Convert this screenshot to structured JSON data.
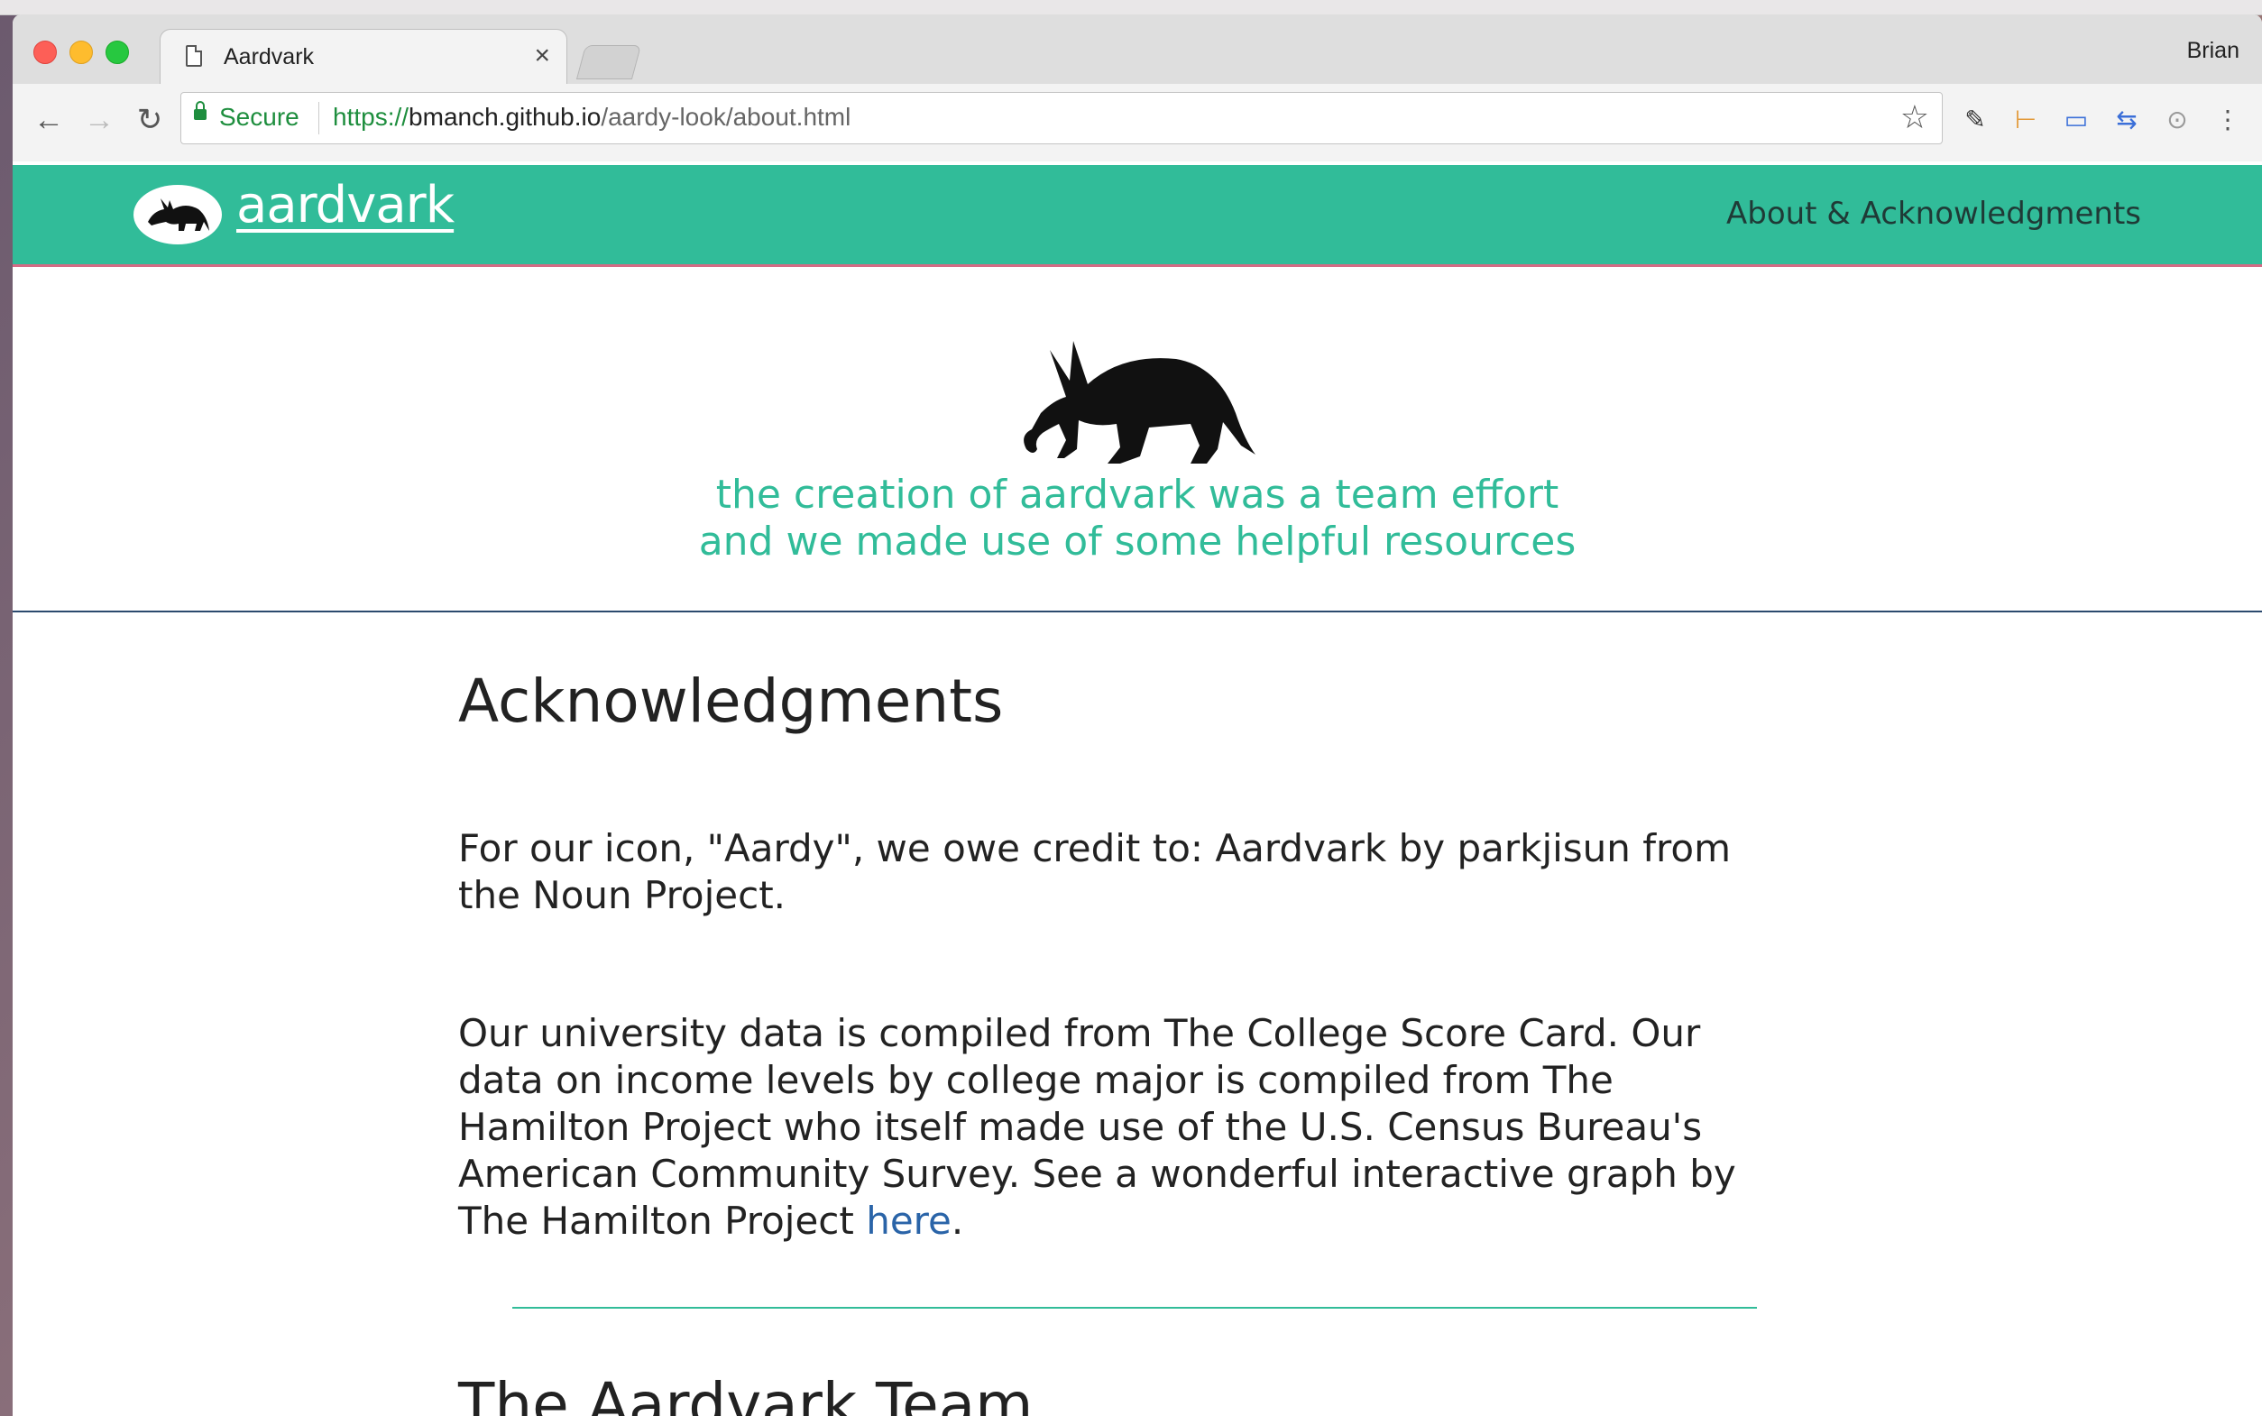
{
  "browser": {
    "tab_title": "Aardvark",
    "tab_close": "×",
    "profile_name": "Brian",
    "secure_label": "Secure",
    "url_scheme": "https://",
    "url_host": "bmanch.github.io",
    "url_path": "/aardy-look/about.html"
  },
  "site": {
    "brand": "aardvark",
    "nav_link": "About & Acknowledgments",
    "hero_line1": "the creation of aardvark was a team effort",
    "hero_line2": "and we made use of some helpful resources",
    "ack_heading": "Acknowledgments",
    "ack_p1": "For our icon, \"Aardy\", we owe credit to: Aardvark by parkjisun from the Noun Project.",
    "ack_p2_text": "Our university data is compiled from The College Score Card. Our data on income levels by college major is compiled from The Hamilton Project who itself made use of the U.S. Census Bureau's American Community Survey. See a wonderful interactive graph by The Hamilton Project ",
    "ack_p2_link": "here",
    "ack_p2_end": ".",
    "team_heading": "The Aardvark Team"
  },
  "colors": {
    "nav_bg": "#31bc99",
    "accent_text": "#31bc99",
    "link": "#2a64a8",
    "nav_border": "#d46b85"
  }
}
